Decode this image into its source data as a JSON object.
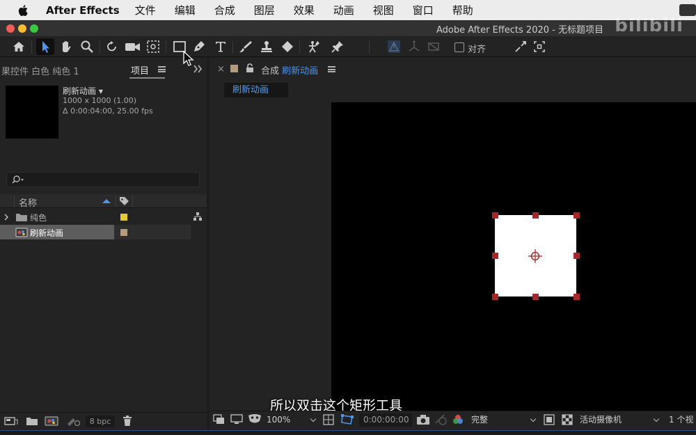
{
  "menubar": {
    "app_name": "After Effects",
    "items": [
      "文件",
      "编辑",
      "合成",
      "图层",
      "效果",
      "动画",
      "视图",
      "窗口",
      "帮助"
    ]
  },
  "window": {
    "title": "Adobe After Effects 2020 - 无标题项目",
    "watermark": "bilibili",
    "traffic_lights": [
      "#ee5e57",
      "#f5bd2f",
      "#39c840"
    ]
  },
  "toolbar": {
    "align_label": "对齐",
    "tools": [
      "home-icon",
      "selection-icon",
      "hand-icon",
      "zoom-icon",
      "rotate-icon",
      "camera-icon",
      "pan-behind-icon",
      "rectangle-icon",
      "pen-icon",
      "type-icon",
      "brush-icon",
      "clone-stamp-icon",
      "eraser-icon",
      "roto-brush-icon",
      "puppet-pin-icon"
    ],
    "selected_tool": "selection-icon"
  },
  "left_panel": {
    "tab_effects": "果控件 白色 纯色 1",
    "tab_project": "项目",
    "comp_name": "刷新动画 ▾",
    "comp_size": "1000 x 1000 (1.00)",
    "comp_duration": "Δ 0:00:04:00, 25.00 fps",
    "search_placeholder": "",
    "column_name": "名称",
    "rows": [
      {
        "label": "纯色",
        "type": "folder",
        "color": "#e6c93a"
      },
      {
        "label": "刷新动画",
        "type": "composition",
        "color": "#b49b7a",
        "selected": true
      }
    ],
    "bpc": "8 bpc"
  },
  "comp_panel": {
    "tab_prefix": "合成",
    "tab_name": "刷新动画",
    "sub_tab": "刷新动画",
    "zoom": "100%",
    "timecode": "0:00:00:00",
    "resolution": "完整",
    "camera": "活动摄像机",
    "views": "1 个视"
  },
  "subtitle": "所以双击这个矩形工具",
  "colors": {
    "accent_blue": "#4d95ef",
    "handle_red": "#a52727"
  }
}
